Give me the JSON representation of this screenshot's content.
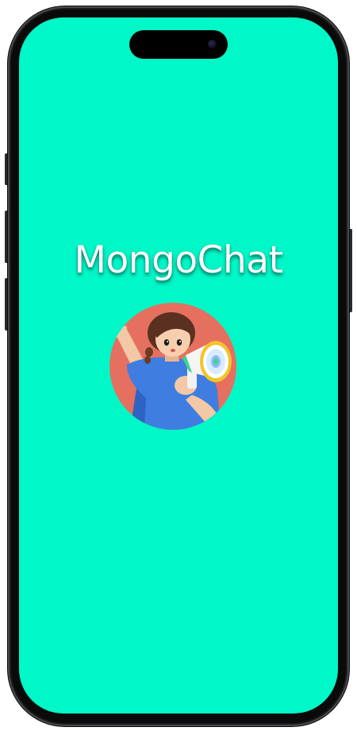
{
  "app": {
    "title": "MongoChat"
  },
  "avatar": {
    "icon": "person-with-megaphone-illustration"
  },
  "colors": {
    "background": "#00f7c8",
    "title_text": "#ffffff",
    "avatar_bg": "#e5705f",
    "shirt": "#3f7ee0",
    "megaphone_accent": "#f2c32c"
  }
}
